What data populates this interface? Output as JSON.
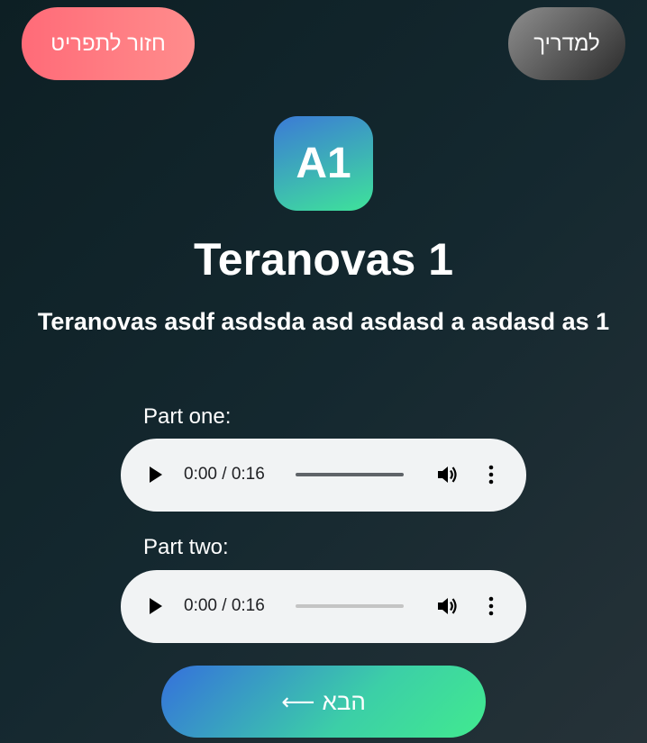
{
  "header": {
    "back_label": "חזור לתפריט",
    "guide_label": "למדריך"
  },
  "lesson": {
    "badge": "A1",
    "title": "Teranovas 1",
    "subtitle": "Teranovas asdf asdsda asd asdasd a asdasd as 1"
  },
  "parts": [
    {
      "label": "Part one:",
      "time": "0:00 / 0:16",
      "progress": 0
    },
    {
      "label": "Part two:",
      "time": "0:00 / 0:16",
      "progress": 0
    }
  ],
  "footer": {
    "next_label": "הבא",
    "next_arrow": "⟵"
  },
  "icons": {
    "play": "play-icon",
    "volume": "volume-icon",
    "more": "more-vertical-icon"
  },
  "colors": {
    "back_gradient": [
      "#ff6b78",
      "#ff8c8c"
    ],
    "guide_gradient": [
      "#8f8f8f",
      "#2b2b2b"
    ],
    "accent_gradient": [
      "#3570dc",
      "#41ea8f"
    ]
  }
}
